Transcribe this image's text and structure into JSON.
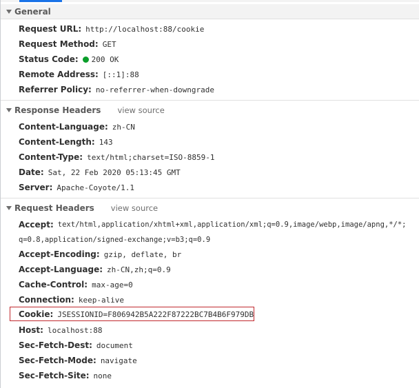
{
  "general": {
    "title": "General",
    "rows": [
      {
        "name": "Request URL:",
        "value": "http://localhost:88/cookie"
      },
      {
        "name": "Request Method:",
        "value": "GET"
      },
      {
        "name": "Status Code:",
        "value": "200 OK"
      },
      {
        "name": "Remote Address:",
        "value": "[::1]:88"
      },
      {
        "name": "Referrer Policy:",
        "value": "no-referrer-when-downgrade"
      }
    ]
  },
  "response_headers": {
    "title": "Response Headers",
    "view_source": "view source",
    "rows": [
      {
        "name": "Content-Language:",
        "value": "zh-CN"
      },
      {
        "name": "Content-Length:",
        "value": "143"
      },
      {
        "name": "Content-Type:",
        "value": "text/html;charset=ISO-8859-1"
      },
      {
        "name": "Date:",
        "value": "Sat, 22 Feb 2020 05:13:45 GMT"
      },
      {
        "name": "Server:",
        "value": "Apache-Coyote/1.1"
      }
    ]
  },
  "request_headers": {
    "title": "Request Headers",
    "view_source": "view source",
    "rows": [
      {
        "name": "Accept:",
        "value": "text/html,application/xhtml+xml,application/xml;q=0.9,image/webp,image/apng,*/*;"
      },
      {
        "name": "",
        "value": "q=0.8,application/signed-exchange;v=b3;q=0.9"
      },
      {
        "name": "Accept-Encoding:",
        "value": "gzip, deflate, br"
      },
      {
        "name": "Accept-Language:",
        "value": "zh-CN,zh;q=0.9"
      },
      {
        "name": "Cache-Control:",
        "value": "max-age=0"
      },
      {
        "name": "Connection:",
        "value": "keep-alive"
      },
      {
        "name": "Cookie:",
        "value": "JSESSIONID=F806942B5A222F87222BC7B4B6F979DB"
      },
      {
        "name": "Host:",
        "value": "localhost:88"
      },
      {
        "name": "Sec-Fetch-Dest:",
        "value": "document"
      },
      {
        "name": "Sec-Fetch-Mode:",
        "value": "navigate"
      },
      {
        "name": "Sec-Fetch-Site:",
        "value": "none"
      }
    ]
  },
  "colors": {
    "status_ok": "#0a9e2a",
    "highlight_border": "#c0282d",
    "active_tab": "#1a73e8"
  }
}
